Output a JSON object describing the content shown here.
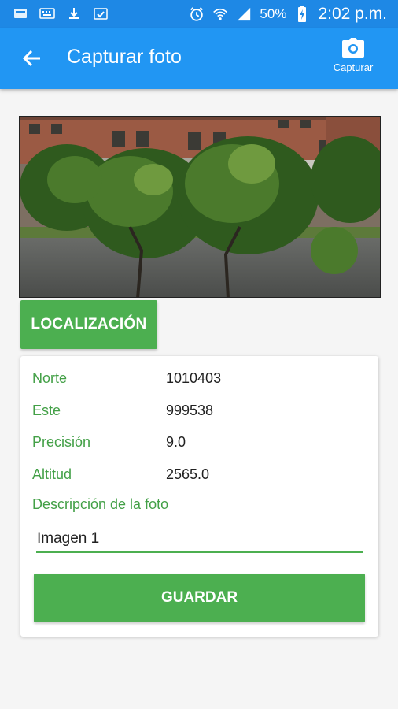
{
  "status_bar": {
    "battery_percent": "50%",
    "time": "2:02 p.m.",
    "icons": [
      "notification-icon",
      "keyboard-icon",
      "download-icon",
      "clipboard-check-icon",
      "alarm-icon",
      "wifi-icon",
      "signal-icon",
      "battery-charging-icon"
    ]
  },
  "app_bar": {
    "title": "Capturar foto",
    "capture_label": "Capturar",
    "colors": {
      "primary": "#2196f3",
      "status": "#1e88e5"
    }
  },
  "location_button": {
    "label": "LOCALIZACIÓN"
  },
  "fields": [
    {
      "label": "Norte",
      "value": "1010403"
    },
    {
      "label": "Este",
      "value": "999538"
    },
    {
      "label": "Precisión",
      "value": "9.0"
    },
    {
      "label": "Altitud",
      "value": "2565.0"
    }
  ],
  "description": {
    "label": "Descripción de la foto",
    "value": "Imagen 1"
  },
  "save_button": {
    "label": "GUARDAR"
  },
  "accent_color": "#4caf50"
}
